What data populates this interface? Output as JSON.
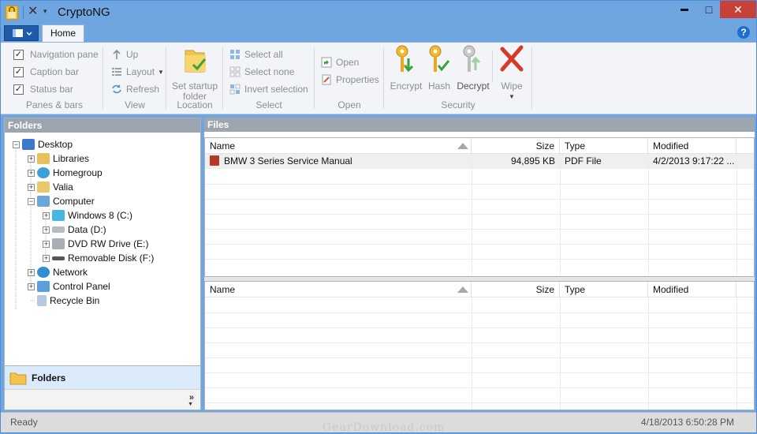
{
  "app": {
    "title": "CryptoNG"
  },
  "window_controls": {
    "minimize": "▬",
    "maximize": "□",
    "close": "✕"
  },
  "ribbon": {
    "tabs": [
      {
        "label": "Home"
      }
    ],
    "help": "?",
    "panes_bars": {
      "label": "Panes & bars",
      "items": [
        {
          "label": "Navigation pane",
          "checked": true
        },
        {
          "label": "Caption bar",
          "checked": true
        },
        {
          "label": "Status bar",
          "checked": true
        }
      ]
    },
    "view": {
      "label": "View",
      "up": "Up",
      "layout": "Layout",
      "refresh": "Refresh"
    },
    "location": {
      "label": "Location",
      "set_startup": "Set startup",
      "folder": "folder"
    },
    "select": {
      "label": "Select",
      "select_all": "Select all",
      "select_none": "Select none",
      "invert": "Invert selection"
    },
    "open": {
      "label": "Open",
      "open": "Open",
      "properties": "Properties"
    },
    "security": {
      "label": "Security",
      "encrypt": "Encrypt",
      "hash": "Hash",
      "decrypt": "Decrypt",
      "wipe": "Wipe"
    }
  },
  "folders": {
    "title": "Folders",
    "tree": [
      {
        "label": "Desktop",
        "expander": "−",
        "icon": "desktop-icon"
      },
      {
        "label": "Libraries",
        "expander": "+",
        "icon": "libraries-icon"
      },
      {
        "label": "Homegroup",
        "expander": "+",
        "icon": "homegroup-icon"
      },
      {
        "label": "Valia",
        "expander": "+",
        "icon": "user-folder-icon"
      },
      {
        "label": "Computer",
        "expander": "−",
        "icon": "computer-icon"
      },
      {
        "label": "Windows 8 (C:)",
        "expander": "+",
        "icon": "windows-drive-icon"
      },
      {
        "label": "Data (D:)",
        "expander": "+",
        "icon": "drive-icon"
      },
      {
        "label": "DVD RW Drive (E:)",
        "expander": "+",
        "icon": "dvd-drive-icon"
      },
      {
        "label": "Removable Disk (F:)",
        "expander": "+",
        "icon": "removable-disk-icon"
      },
      {
        "label": "Network",
        "expander": "+",
        "icon": "network-icon"
      },
      {
        "label": "Control Panel",
        "expander": "+",
        "icon": "control-panel-icon"
      },
      {
        "label": "Recycle Bin",
        "expander": "",
        "icon": "recycle-bin-icon"
      }
    ],
    "footer": "Folders",
    "chevron": "»"
  },
  "files": {
    "title": "Files",
    "columns": {
      "name": "Name",
      "size": "Size",
      "type": "Type",
      "modified": "Modified"
    },
    "rows": [
      {
        "name": "BMW 3 Series Service Manual",
        "size": "94,895 KB",
        "type": "PDF File",
        "modified": "4/2/2013 9:17:22 ..."
      }
    ]
  },
  "status": {
    "text": "Ready",
    "datetime": "4/18/2013 6:50:28 PM",
    "watermark": "GearDownload.com"
  },
  "colors": {
    "accent": "#6fa6e2",
    "ribbon_bg": "#f2f4f7",
    "header_gray": "#9ca5b0",
    "close_red": "#c7403a"
  }
}
